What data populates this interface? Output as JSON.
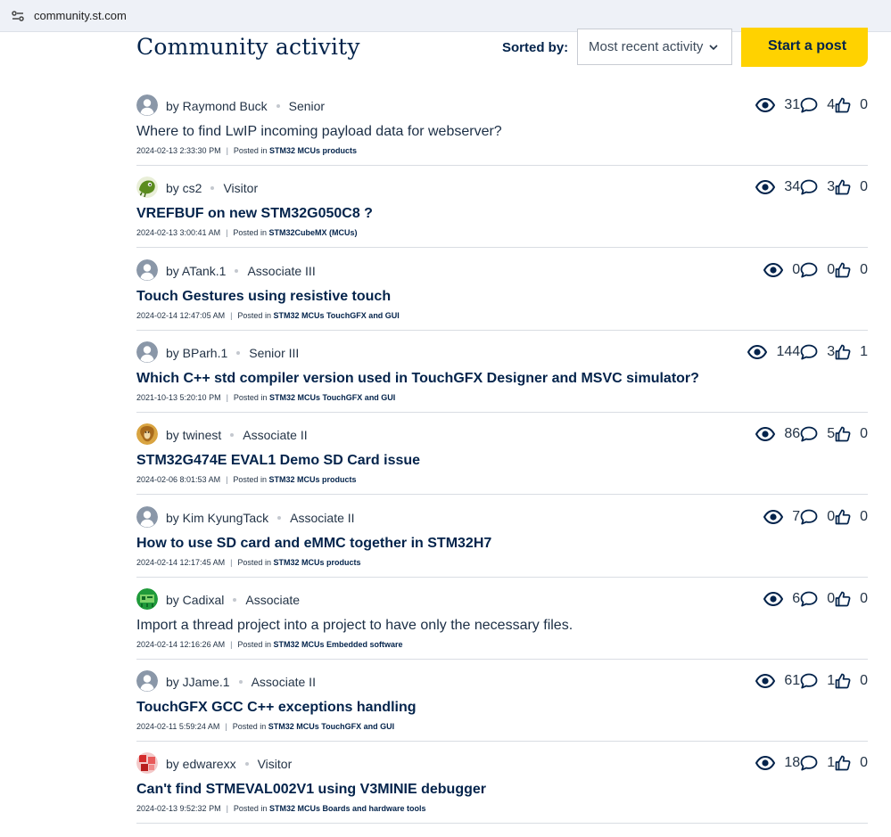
{
  "browser": {
    "url": "community.st.com"
  },
  "header": {
    "title": "Community activity",
    "sorted_label": "Sorted by:",
    "sort_value": "Most recent activity",
    "start_post_label": "Start a post"
  },
  "colors": {
    "brand_navy": "#03234b",
    "accent_yellow": "#ffd200"
  },
  "posts": [
    {
      "author": "by Raymond Buck",
      "rank": "Senior",
      "title": "Where to find LwIP incoming payload data for webserver?",
      "timestamp": "2024-02-13 2:33:30 PM",
      "posted_in": "Posted in",
      "board": "STM32 MCUs products",
      "views": "31",
      "replies": "4",
      "kudos": "0",
      "avatar": "default-avatar-icon"
    },
    {
      "author": "by cs2",
      "rank": "Visitor",
      "title": "VREFBUF on new STM32G050C8 ?",
      "timestamp": "2024-02-13 3:00:41 AM",
      "posted_in": "Posted in",
      "board": "STM32CubeMX (MCUs)",
      "views": "34",
      "replies": "3",
      "kudos": "0",
      "avatar": "green-creature-avatar"
    },
    {
      "author": "by ATank.1",
      "rank": "Associate III",
      "title": "Touch Gestures using resistive touch",
      "timestamp": "2024-02-14 12:47:05 AM",
      "posted_in": "Posted in",
      "board": "STM32 MCUs TouchGFX and GUI",
      "views": "0",
      "replies": "0",
      "kudos": "0",
      "avatar": "default-avatar-icon"
    },
    {
      "author": "by BParh.1",
      "rank": "Senior III",
      "title": "Which C++ std compiler version used in TouchGFX Designer and MSVC simulator?",
      "timestamp": "2021-10-13 5:20:10 PM",
      "posted_in": "Posted in",
      "board": "STM32 MCUs TouchGFX and GUI",
      "views": "144",
      "replies": "3",
      "kudos": "1",
      "avatar": "default-avatar-icon"
    },
    {
      "author": "by twinest",
      "rank": "Associate II",
      "title": "STM32G474E EVAL1 Demo SD Card issue",
      "timestamp": "2024-02-06 8:01:53 AM",
      "posted_in": "Posted in",
      "board": "STM32 MCUs products",
      "views": "86",
      "replies": "5",
      "kudos": "0",
      "avatar": "orange-dog-avatar"
    },
    {
      "author": "by Kim KyungTack",
      "rank": "Associate II",
      "title": "How to use SD card and eMMC together in STM32H7",
      "timestamp": "2024-02-14 12:17:45 AM",
      "posted_in": "Posted in",
      "board": "STM32 MCUs products",
      "views": "7",
      "replies": "0",
      "kudos": "0",
      "avatar": "default-avatar-icon"
    },
    {
      "author": "by Cadixal",
      "rank": "Associate",
      "title": "Import a thread project into a project to have only the necessary files.",
      "timestamp": "2024-02-14 12:16:26 AM",
      "posted_in": "Posted in",
      "board": "STM32 MCUs Embedded software",
      "views": "6",
      "replies": "0",
      "kudos": "0",
      "avatar": "green-board-avatar"
    },
    {
      "author": "by JJame.1",
      "rank": "Associate II",
      "title": "TouchGFX GCC C++ exceptions handling",
      "timestamp": "2024-02-11 5:59:24 AM",
      "posted_in": "Posted in",
      "board": "STM32 MCUs TouchGFX and GUI",
      "views": "61",
      "replies": "1",
      "kudos": "0",
      "avatar": "default-avatar-icon"
    },
    {
      "author": "by edwarexx",
      "rank": "Visitor",
      "title": "Can't find STMEVAL002V1 using V3MINIE debugger",
      "timestamp": "2024-02-13 9:52:32 PM",
      "posted_in": "Posted in",
      "board": "STM32 MCUs Boards and hardware tools",
      "views": "18",
      "replies": "1",
      "kudos": "0",
      "avatar": "red-pattern-avatar"
    }
  ]
}
